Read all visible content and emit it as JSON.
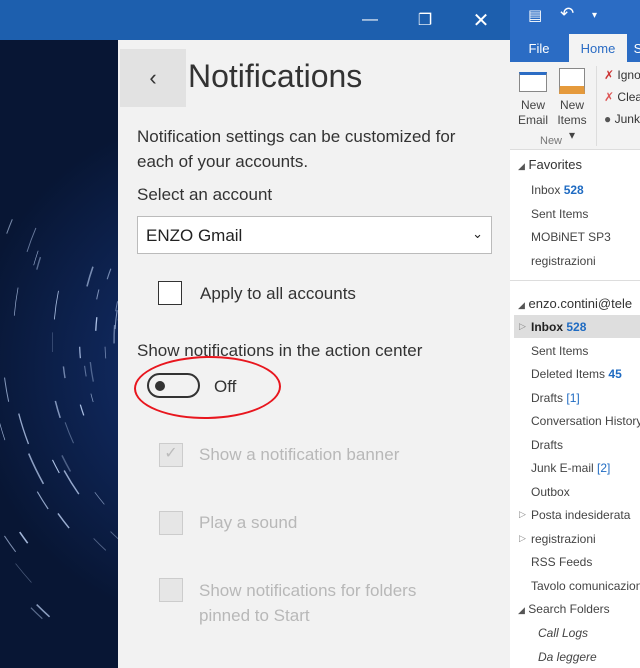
{
  "window": {
    "controls": [
      "minimize",
      "maximize",
      "close"
    ]
  },
  "settings": {
    "title": "Notifications",
    "back_icon": "chevron-left-icon",
    "description": "Notification settings can be customized for each of your accounts.",
    "select_label": "Select an account",
    "selected_account": "ENZO Gmail",
    "apply_all": {
      "label": "Apply to all accounts",
      "checked": false
    },
    "show_in_action_center": {
      "label": "Show notifications in the action center",
      "state": "Off",
      "on": false
    },
    "options": [
      {
        "label": "Show a notification banner",
        "checked": true,
        "disabled": true
      },
      {
        "label": "Play a sound",
        "checked": false,
        "disabled": true
      },
      {
        "label": "Show notifications for folders pinned to Start",
        "checked": false,
        "disabled": true
      }
    ],
    "annotation_color": "#e8161e"
  },
  "outlook": {
    "tabs": [
      "File",
      "Home",
      "S"
    ],
    "ribbon": {
      "new_email": "New Email",
      "new_items": "New Items",
      "group": "New",
      "small": [
        "Ignore",
        "Clean Up",
        "Junk"
      ]
    },
    "favorites": {
      "header": "Favorites",
      "items": [
        {
          "name": "Inbox",
          "count": "528"
        },
        {
          "name": "Sent Items"
        },
        {
          "name": "MOBiNET SP3"
        },
        {
          "name": "registrazioni"
        }
      ]
    },
    "account": {
      "header": "enzo.contini@tele",
      "items": [
        {
          "name": "Inbox",
          "count": "528",
          "bold": true,
          "selected": true
        },
        {
          "name": "Sent Items"
        },
        {
          "name": "Deleted Items",
          "count": "45"
        },
        {
          "name": "Drafts",
          "bracket": "[1]"
        },
        {
          "name": "Conversation History"
        },
        {
          "name": "Drafts"
        },
        {
          "name": "Junk E-mail",
          "bracket": "[2]"
        },
        {
          "name": "Outbox"
        },
        {
          "name": "Posta indesiderata"
        },
        {
          "name": "registrazioni"
        },
        {
          "name": "RSS Feeds"
        },
        {
          "name": "Tavolo comunicazioni"
        }
      ]
    },
    "search_folders": {
      "header": "Search Folders",
      "items": [
        "Call Logs",
        "Da leggere"
      ]
    },
    "accent": "#2b6cc4"
  }
}
